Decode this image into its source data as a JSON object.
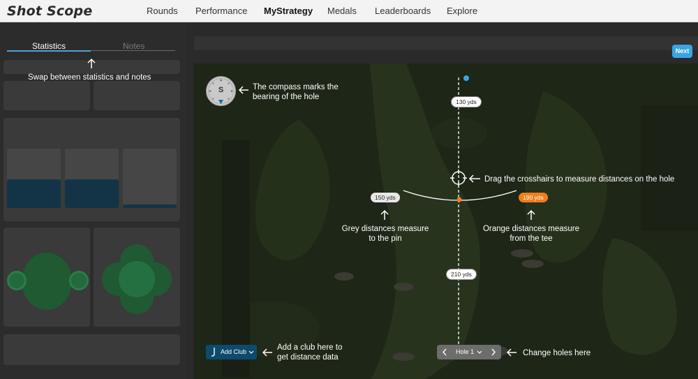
{
  "logo": "Shot Scope",
  "nav": {
    "items": [
      "Rounds",
      "Performance",
      "MyStrategy",
      "Medals",
      "Leaderboards",
      "Explore"
    ],
    "active": "MyStrategy"
  },
  "tabs": {
    "statistics": "Statistics",
    "notes": "Notes"
  },
  "hints": {
    "tabs": "Swap between statistics and notes",
    "compass": [
      "The compass marks the",
      "bearing of the hole"
    ],
    "crosshairs": "Drag the crosshairs to measure distances on the hole",
    "grey": [
      "Grey distances measure",
      "to the pin"
    ],
    "orange": [
      "Orange distances measure",
      "from the tee"
    ],
    "add_club": [
      "Add a club here to",
      "get distance data"
    ],
    "holes": "Change holes here"
  },
  "map": {
    "compass_label": "S",
    "pin_distance": "130 yds",
    "grey_distance": "150 yds",
    "orange_distance": "190 yds",
    "tee_distance": "210 yds"
  },
  "buttons": {
    "next": "Next",
    "add_club": "Add Club",
    "hole": "Hole 1"
  },
  "colors": {
    "accent_blue": "#3aa4e6",
    "orange": "#f07d1c",
    "dark_teal": "#0d4a6d"
  }
}
